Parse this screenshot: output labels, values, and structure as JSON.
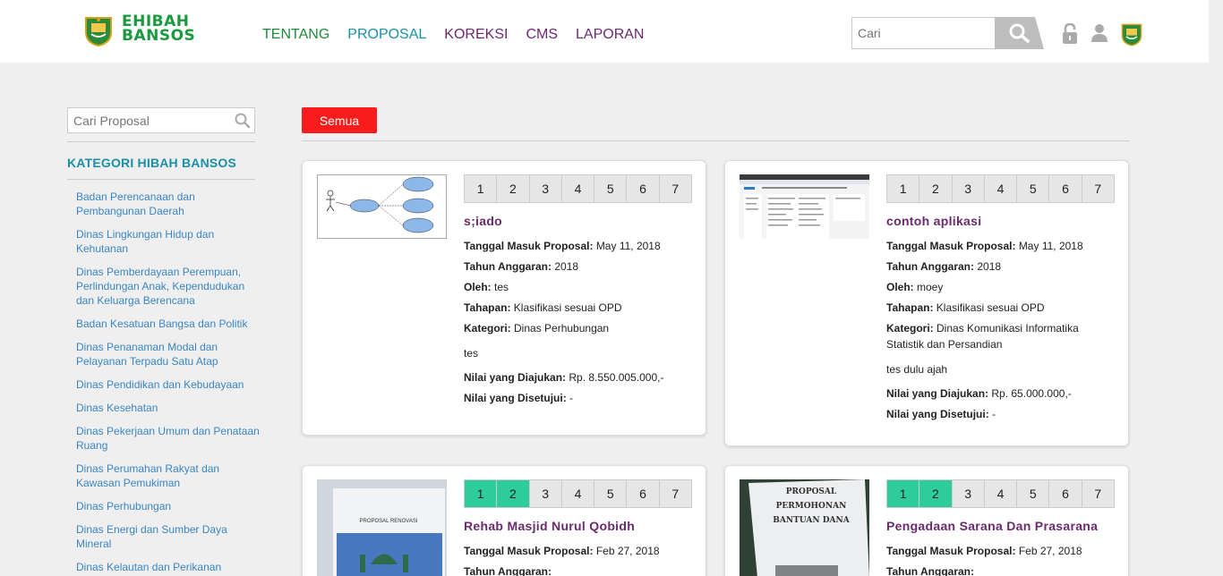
{
  "header": {
    "brand_line1": "EHIBAH",
    "brand_line2": "BANSOS",
    "nav": [
      "TENTANG",
      "PROPOSAL",
      "KOREKSI",
      "CMS",
      "LAPORAN"
    ],
    "search_placeholder": "Cari",
    "icons": [
      "lock-icon",
      "user-icon",
      "emblem-icon"
    ]
  },
  "sidebar": {
    "search_placeholder": "Cari Proposal",
    "title": "KATEGORI HIBAH BANSOS",
    "categories": [
      "Badan Perencanaan dan Pembangunan Daerah",
      "Dinas Lingkungan Hidup dan Kehutanan",
      "Dinas Pemberdayaan Perempuan, Perlindungan Anak, Kependudukan dan Keluarga Berencana",
      "Badan Kesatuan Bangsa dan Politik",
      "Dinas Penanaman Modal dan Pelayanan Terpadu Satu Atap",
      "Dinas Pendidikan dan Kebudayaan",
      "Dinas Kesehatan",
      "Dinas Pekerjaan Umum dan Penataan Ruang",
      "Dinas Perumahan Rakyat dan Kawasan Pemukiman",
      "Dinas Perhubungan",
      "Dinas Energi dan Sumber Daya Mineral",
      "Dinas Kelautan dan Perikanan"
    ]
  },
  "filter": {
    "label": "Semua",
    "color": "#f81c1c"
  },
  "labels": {
    "tanggal": "Tanggal Masuk Proposal:",
    "tahun": "Tahun Anggaran:",
    "oleh": "Oleh:",
    "tahapan": "Tahapan:",
    "kategori": "Kategori:",
    "diajukan": "Nilai yang Diajukan:",
    "disetujui": "Nilai yang Disetujui:"
  },
  "steps": [
    "1",
    "2",
    "3",
    "4",
    "5",
    "6",
    "7"
  ],
  "cards": [
    {
      "title": "s;iado",
      "tanggal": "May 11, 2018",
      "tahun": "2018",
      "oleh": "tes",
      "tahapan": "Klasifikasi sesuai OPD",
      "kategori": "Dinas Perhubungan",
      "desc": "tes",
      "diajukan": "Rp. 8.550.005.000,-",
      "disetujui": "-",
      "steps_done": 0
    },
    {
      "title": "contoh aplikasi",
      "tanggal": "May 11, 2018",
      "tahun": "2018",
      "oleh": "moey",
      "tahapan": "Klasifikasi sesuai OPD",
      "kategori": "Dinas Komunikasi Informatika Statistik dan Persandian",
      "desc": "tes dulu ajah",
      "diajukan": "Rp. 65.000.000,-",
      "disetujui": "-",
      "steps_done": 0
    },
    {
      "title": "Rehab Masjid Nurul Qobidh",
      "tanggal": "Feb 27, 2018",
      "steps_done": 2,
      "thumb_text": "PROPOSAL RENOVASI"
    },
    {
      "title": "Pengadaan Sarana Dan Prasarana",
      "tanggal": "Feb 27, 2018",
      "steps_done": 2,
      "thumb_text": "PROPOSAL PERMOHONAN BANTUAN DANA"
    }
  ]
}
